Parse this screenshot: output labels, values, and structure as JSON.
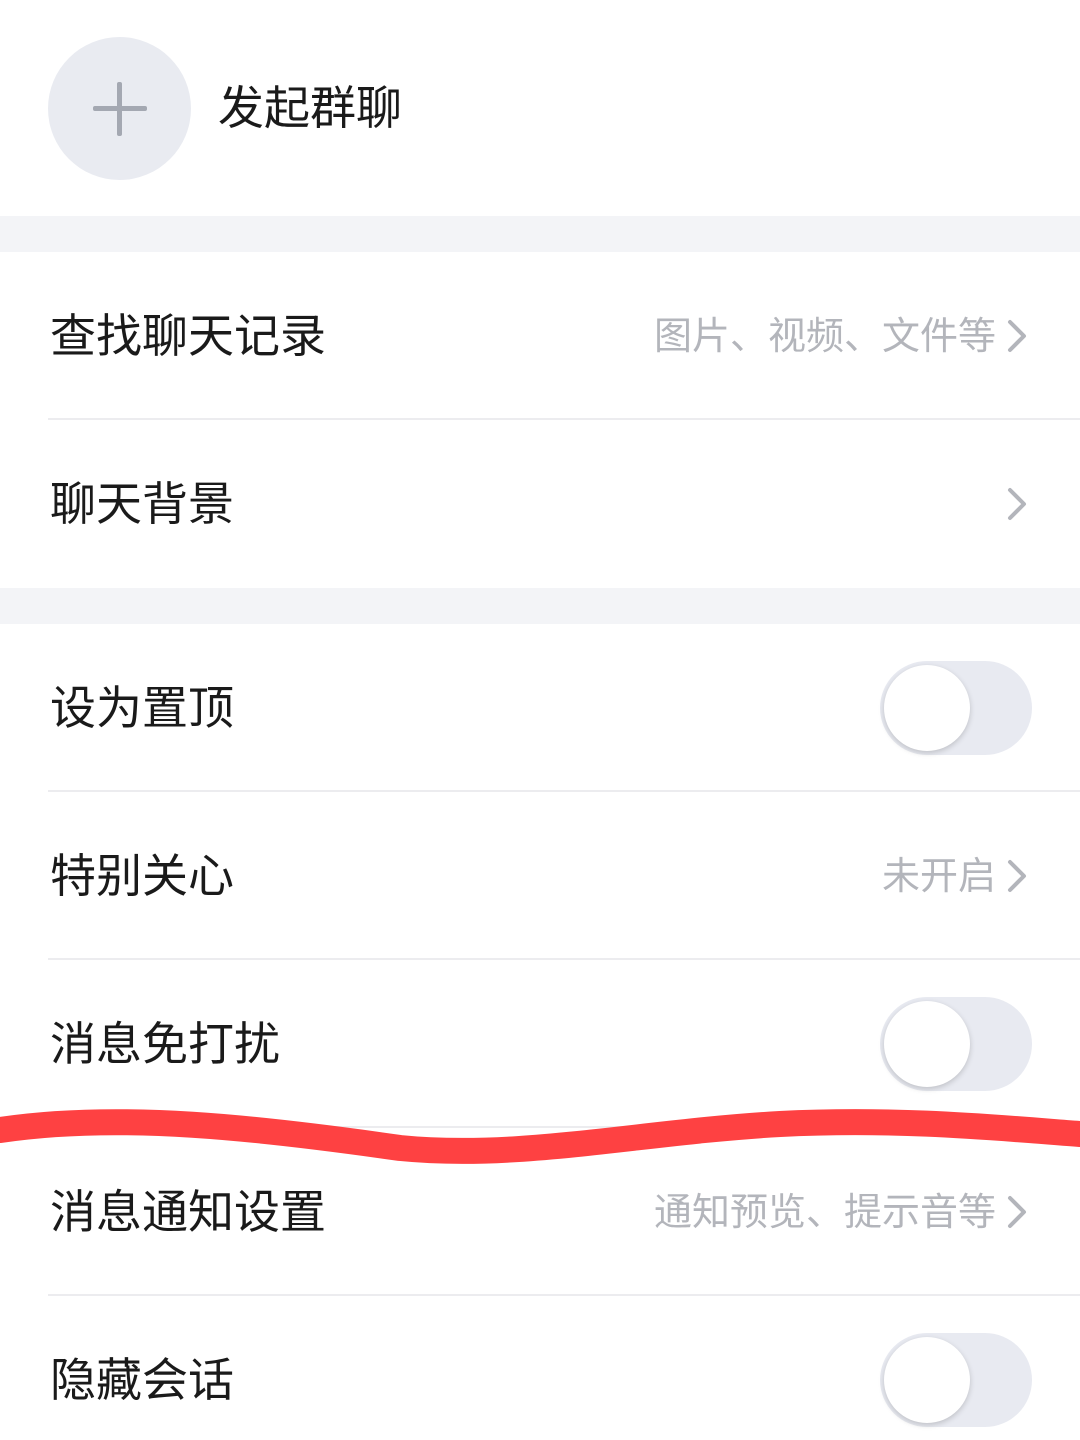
{
  "start_group_chat": {
    "icon": "plus-icon",
    "label": "发起群聊"
  },
  "rows": {
    "search_history": {
      "label": "查找聊天记录",
      "value": "图片、视频、文件等"
    },
    "chat_background": {
      "label": "聊天背景"
    },
    "pin_top": {
      "label": "设为置顶",
      "toggle_on": false
    },
    "special_care": {
      "label": "特别关心",
      "value": "未开启"
    },
    "do_not_disturb": {
      "label": "消息免打扰",
      "toggle_on": false
    },
    "notification_settings": {
      "label": "消息通知设置",
      "value": "通知预览、提示音等"
    },
    "hide_conversation": {
      "label": "隐藏会话",
      "toggle_on": false
    }
  },
  "colors": {
    "background": "#ffffff",
    "section_gap": "#f3f4f7",
    "secondary_text": "#b3b5bb",
    "toggle_off": "#e8eaf1",
    "annotation_stroke": "#fe4142"
  },
  "icons": {
    "chevron": "chevron-right-icon"
  }
}
